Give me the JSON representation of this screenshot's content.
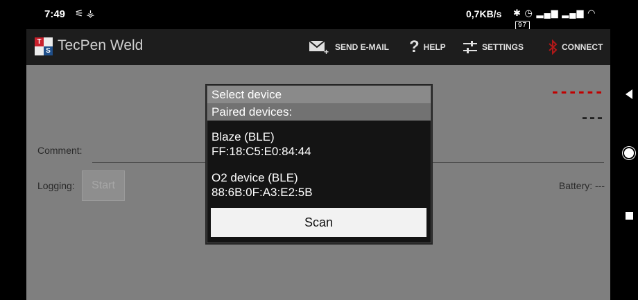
{
  "status_bar": {
    "time": "7:49",
    "left_icons": "⚟ ⚶",
    "network_speed": "0,7KB/s",
    "right_icons": "✱ ◷ ▂▄▆ ▂▄▆ ◠",
    "battery_level": "97"
  },
  "action_bar": {
    "app_title": "TecPen Weld",
    "logo_letters": [
      "T",
      "S"
    ],
    "actions": [
      {
        "label": "SEND E-MAIL",
        "icon": "email-icon"
      },
      {
        "label": "HELP",
        "icon": "help-icon"
      },
      {
        "label": "SETTINGS",
        "icon": "settings-icon"
      },
      {
        "label": "CONNECT",
        "icon": "bluetooth-icon"
      }
    ]
  },
  "main": {
    "reading_dashes": "------",
    "secondary_dashes": "---",
    "comment_label": "Comment:",
    "logging_label": "Logging:",
    "start_button": "Start",
    "battery_label": "Battery: ---"
  },
  "dialog": {
    "title": "Select device",
    "section_header": "Paired devices:",
    "devices": [
      {
        "name": "Blaze (BLE)",
        "address": "FF:18:C5:E0:84:44"
      },
      {
        "name": "O2 device (BLE)",
        "address": "88:6B:0F:A3:E2:5B"
      }
    ],
    "scan_button": "Scan"
  },
  "colors": {
    "action_bar": "#1d1d1d",
    "content_bg": "#7f7f7f",
    "reading_red": "#c00000",
    "bluetooth_red": "#b01818",
    "logo_red": "#c8202c",
    "logo_blue": "#1f4f8a"
  }
}
